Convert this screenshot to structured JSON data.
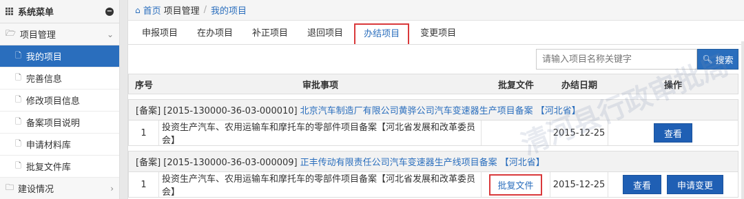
{
  "sidebar": {
    "title": "系统菜单",
    "toggle_icon": "minus-circle-icon",
    "group1": {
      "label": "项目管理"
    },
    "items": [
      {
        "label": "我的项目",
        "active": true
      },
      {
        "label": "完善信息"
      },
      {
        "label": "修改项目信息"
      },
      {
        "label": "备案项目说明"
      },
      {
        "label": "申请材料库"
      },
      {
        "label": "批复文件库"
      }
    ],
    "group2": {
      "label": "建设情况"
    }
  },
  "breadcrumb": {
    "home": "首页",
    "section": "项目管理",
    "current": "我的项目"
  },
  "tabs": [
    {
      "label": "申报项目"
    },
    {
      "label": "在办项目"
    },
    {
      "label": "补正项目"
    },
    {
      "label": "退回项目"
    },
    {
      "label": "办结项目",
      "active": true
    },
    {
      "label": "变更项目"
    }
  ],
  "search": {
    "placeholder": "请输入项目名称关键字",
    "button_label": "搜索"
  },
  "table": {
    "headers": {
      "no": "序号",
      "item": "审批事项",
      "file": "批复文件",
      "date": "办结日期",
      "ops": "操作"
    }
  },
  "projects": [
    {
      "code": "[备案] [2015-130000-36-03-000010]",
      "name": "北京汽车制造厂有限公司黄骅公司汽车变速器生产项目备案 【河北省】",
      "row": {
        "no": "1",
        "item": "投资生产汽车、农用运输车和摩托车的零部件项目备案【河北省发展和改革委员会】",
        "file": "",
        "date": "2015-12-25",
        "view_label": "查看"
      }
    },
    {
      "code": "[备案] [2015-130000-36-03-000009]",
      "name": "正丰传动有限责任公司汽车变速器生产线项目备案 【河北省】",
      "row": {
        "no": "1",
        "item": "投资生产汽车、农用运输车和摩托车的零部件项目备案【河北省发展和改革委员会】",
        "file": "批复文件",
        "date": "2015-12-25",
        "view_label": "查看",
        "change_label": "申请变更"
      }
    }
  ],
  "watermark": "清河县行政审批局",
  "colors": {
    "accent": "#2a6ebd",
    "highlight_border": "#d9383a",
    "button": "#1f5fb4"
  }
}
